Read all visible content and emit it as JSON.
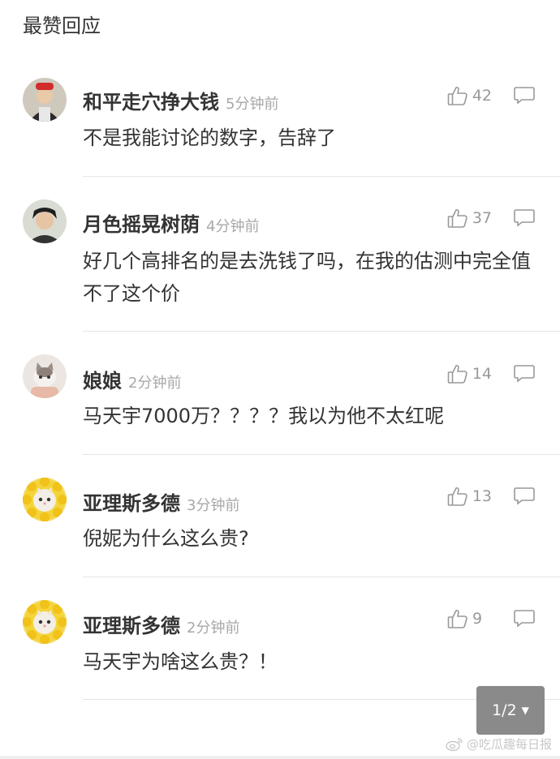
{
  "section": {
    "title": "最赞回应"
  },
  "comments": [
    {
      "name": "和平走穴挣大钱",
      "time": "5分钟前",
      "likes": "42",
      "text": "不是我能讨论的数字，告辞了"
    },
    {
      "name": "月色摇晃树荫",
      "time": "4分钟前",
      "likes": "37",
      "text": "好几个高排名的是去洗钱了吗，在我的估测中完全值不了这个价"
    },
    {
      "name": "娘娘",
      "time": "2分钟前",
      "likes": "14",
      "text": "马天宇7000万？？？？我以为他不太红呢"
    },
    {
      "name": "亚理斯多德",
      "time": "3分钟前",
      "likes": "13",
      "text": "倪妮为什么这么贵?"
    },
    {
      "name": "亚理斯多德",
      "time": "2分钟前",
      "likes": "9",
      "text": "马天宇为啥这么贵？！"
    }
  ],
  "pager": {
    "label": "1/2",
    "arrow": "▼"
  },
  "watermark": {
    "text": "@吃瓜趣每日报"
  },
  "colors": {
    "accent_gray": "#8a8a8a",
    "divider": "#e5e5e5",
    "time": "#a8a8a8"
  }
}
